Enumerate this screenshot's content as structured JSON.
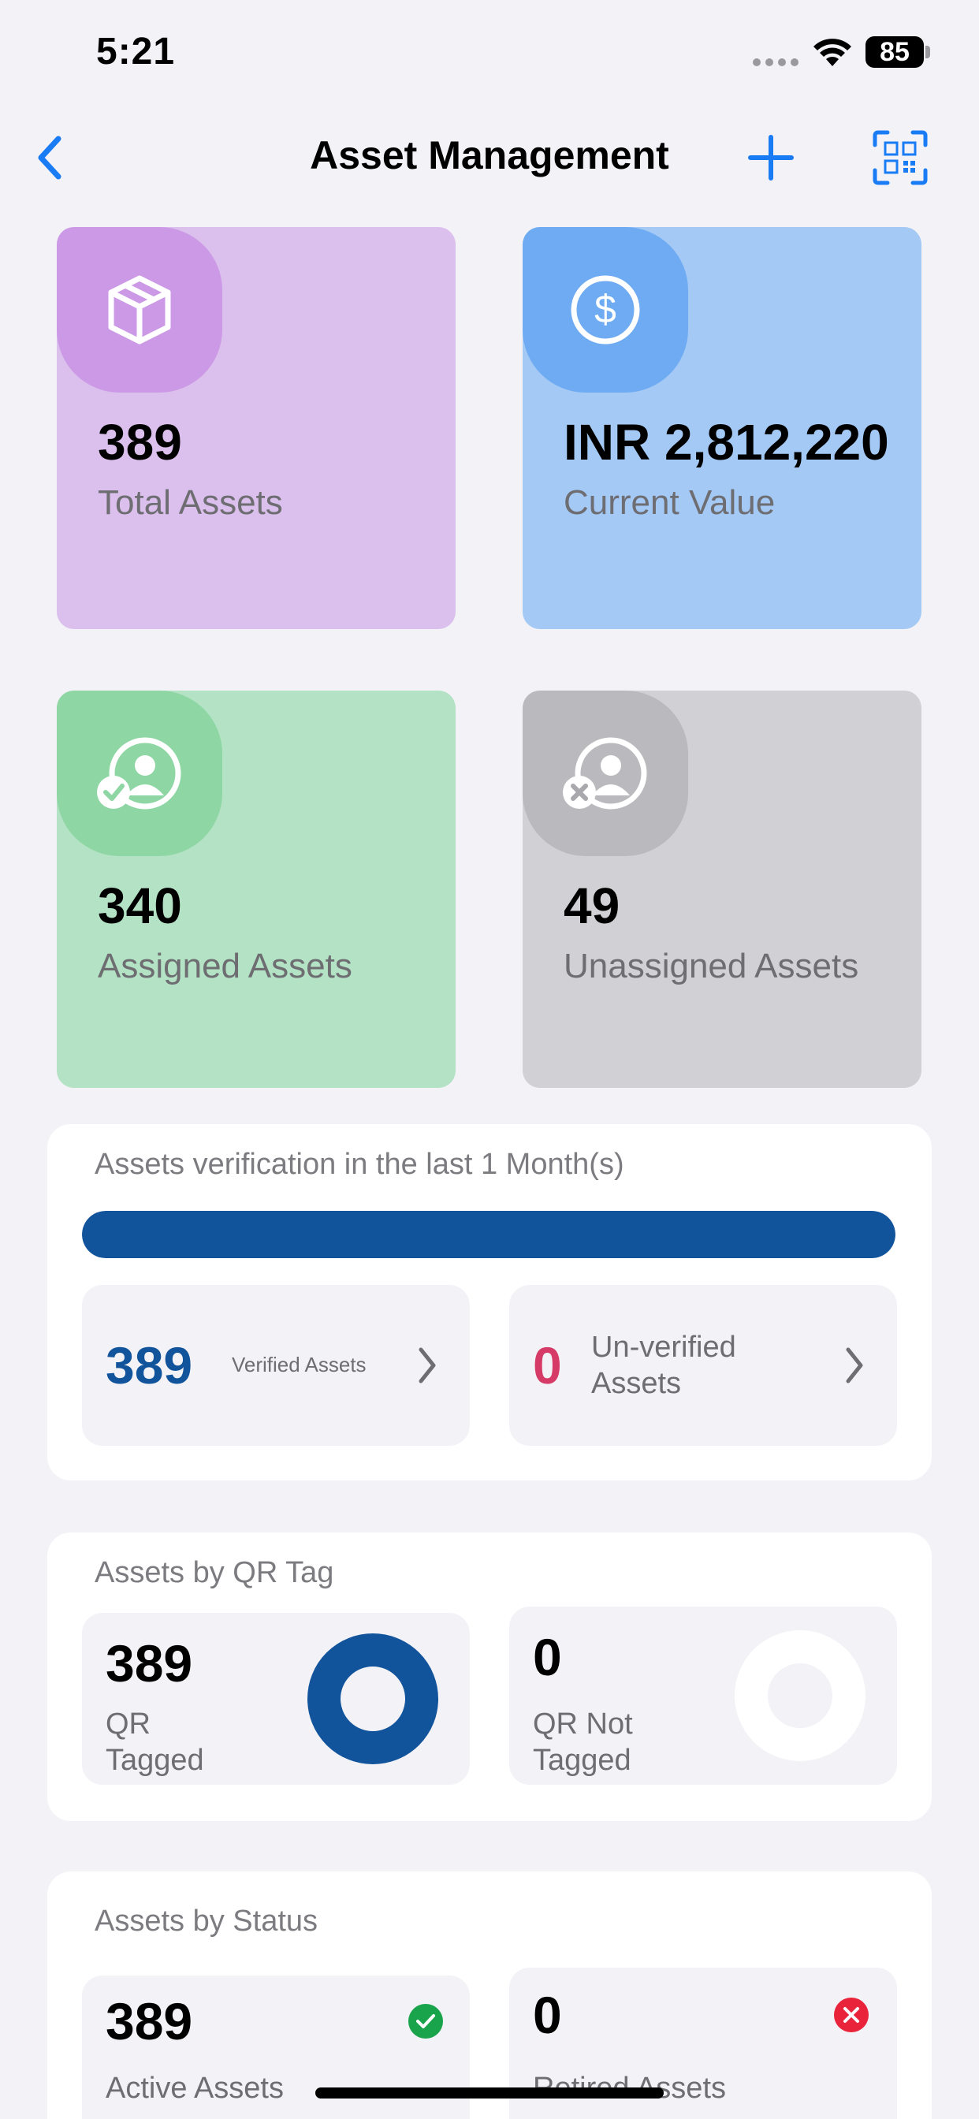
{
  "status_bar": {
    "time": "5:21",
    "battery": "85"
  },
  "nav": {
    "title": "Asset Management",
    "back_icon": "chevron-left-icon",
    "add_icon": "plus-icon",
    "scan_icon": "qr-scan-icon"
  },
  "colors": {
    "accent": "#1a7cf5",
    "primary_blue": "#12549b",
    "danger": "#d63a66",
    "success": "#19a34b",
    "error": "#e8233a"
  },
  "cards": [
    {
      "value": "389",
      "label": "Total Assets",
      "icon": "box-icon",
      "bg": "#dbbfec",
      "bubble": "#cb99e6"
    },
    {
      "value": "INR 2,812,220",
      "label": "Current Value",
      "icon": "dollar-icon",
      "bg": "#a4c9f5",
      "bubble": "#6eabf3"
    },
    {
      "value": "340",
      "label": "Assigned Assets",
      "icon": "user-check-icon",
      "bg": "#b3e2c4",
      "bubble": "#8ed6a3"
    },
    {
      "value": "49",
      "label": "Unassigned Assets",
      "icon": "user-x-icon",
      "bg": "#d1d1d5",
      "bubble": "#bababe"
    }
  ],
  "verification": {
    "title": "Assets verification in the last 1 Month(s)",
    "progress": 1.0,
    "verified_value": "389",
    "verified_label": "Verified Assets",
    "unverified_value": "0",
    "unverified_label": "Un-verified Assets"
  },
  "qr": {
    "title": "Assets by QR Tag",
    "tagged_value": "389",
    "tagged_label": "QR Tagged",
    "not_tagged_value": "0",
    "not_tagged_label": "QR Not Tagged"
  },
  "status": {
    "title": "Assets by Status",
    "active_value": "389",
    "active_label": "Active Assets",
    "active_icon": "check-circle-icon",
    "retired_value": "0",
    "retired_label": "Retired Assets",
    "retired_icon": "x-circle-icon"
  }
}
